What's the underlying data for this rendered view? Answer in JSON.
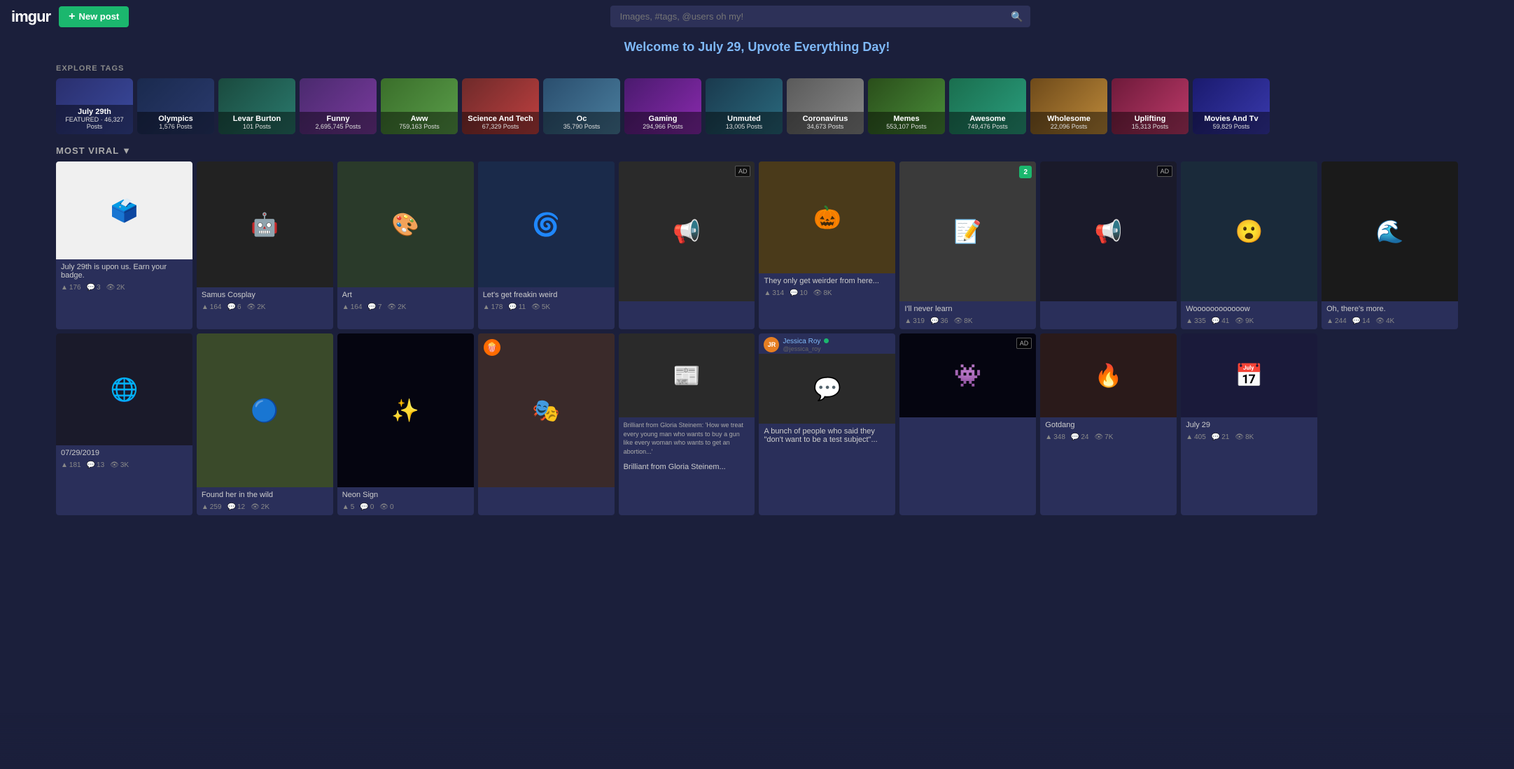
{
  "header": {
    "logo": "imgur",
    "new_post_label": "New post",
    "search_placeholder": "Images, #tags, @users oh my!"
  },
  "welcome": {
    "text": "Welcome to July 29, Upvote Everything Day!"
  },
  "explore": {
    "label": "EXPLORE TAGS",
    "tags": [
      {
        "id": "july29",
        "name": "July 29th",
        "sub": "FEATURED · 46,327 Posts",
        "cls": "tag-featured"
      },
      {
        "id": "olympics",
        "name": "Olympics",
        "sub": "1,576 Posts",
        "cls": "tag-olympics"
      },
      {
        "id": "levar",
        "name": "Levar Burton",
        "sub": "101 Posts",
        "cls": "tag-levar"
      },
      {
        "id": "funny",
        "name": "Funny",
        "sub": "2,695,745 Posts",
        "cls": "tag-funny"
      },
      {
        "id": "aww",
        "name": "Aww",
        "sub": "759,163 Posts",
        "cls": "tag-aww"
      },
      {
        "id": "scitech",
        "name": "Science And Tech",
        "sub": "67,329 Posts",
        "cls": "tag-scitech"
      },
      {
        "id": "oc",
        "name": "Oc",
        "sub": "35,790 Posts",
        "cls": "tag-oc"
      },
      {
        "id": "gaming",
        "name": "Gaming",
        "sub": "294,966 Posts",
        "cls": "tag-gaming"
      },
      {
        "id": "unmuted",
        "name": "Unmuted",
        "sub": "13,005 Posts",
        "cls": "tag-unmuted"
      },
      {
        "id": "coronavirus",
        "name": "Coronavirus",
        "sub": "34,673 Posts",
        "cls": "tag-coronavirus"
      },
      {
        "id": "memes",
        "name": "Memes",
        "sub": "553,107 Posts",
        "cls": "tag-memes"
      },
      {
        "id": "awesome",
        "name": "Awesome",
        "sub": "749,476 Posts",
        "cls": "tag-awesome"
      },
      {
        "id": "wholesome",
        "name": "Wholesome",
        "sub": "22,096 Posts",
        "cls": "tag-wholesome"
      },
      {
        "id": "uplifting",
        "name": "Uplifting",
        "sub": "15,313 Posts",
        "cls": "tag-uplifting"
      },
      {
        "id": "movies",
        "name": "Movies And Tv",
        "sub": "59,829 Posts",
        "cls": "tag-movies"
      }
    ]
  },
  "most_viral": {
    "label": "MOST VIRAL"
  },
  "posts": [
    {
      "id": "upvoted",
      "title": "July 29th is upon us. Earn your badge.",
      "thumb_color": "#f0f0f0",
      "thumb_text": "🗳️",
      "thumb_height": 140,
      "upvotes": "176",
      "comments": "3",
      "views": "2K",
      "has_ad": false,
      "span": 1
    },
    {
      "id": "samus",
      "title": "Samus Cosplay",
      "thumb_color": "#222",
      "thumb_text": "🤖",
      "thumb_height": 180,
      "upvotes": "164",
      "comments": "6",
      "views": "2K",
      "has_ad": false,
      "span": 1
    },
    {
      "id": "art",
      "title": "Art",
      "thumb_color": "#2a3a2a",
      "thumb_text": "🎨",
      "thumb_height": 180,
      "upvotes": "164",
      "comments": "7",
      "views": "2K",
      "has_ad": false,
      "span": 1
    },
    {
      "id": "weird",
      "title": "Let's get freakin weird",
      "thumb_color": "#1a2a4a",
      "thumb_text": "🌀",
      "thumb_height": 180,
      "upvotes": "178",
      "comments": "11",
      "views": "5K",
      "has_ad": false,
      "span": 1
    },
    {
      "id": "ad1",
      "title": "",
      "thumb_color": "#2a2a2a",
      "thumb_text": "📢",
      "thumb_height": 200,
      "upvotes": "",
      "comments": "",
      "views": "",
      "has_ad": true,
      "span": 1
    },
    {
      "id": "pumpkin",
      "title": "They only get weirder from here...",
      "thumb_color": "#4a3a1a",
      "thumb_text": "🎃",
      "thumb_height": 160,
      "upvotes": "314",
      "comments": "10",
      "views": "8K",
      "has_ad": false,
      "span": 1
    },
    {
      "id": "notice",
      "title": "I'll never learn",
      "thumb_color": "#3a3a3a",
      "thumb_text": "📝",
      "thumb_height": 200,
      "upvotes": "319",
      "comments": "36",
      "views": "8K",
      "has_ad": false,
      "num_badge": "2",
      "span": 1
    },
    {
      "id": "ad2",
      "title": "",
      "thumb_color": "#1a1a2a",
      "thumb_text": "📢",
      "thumb_height": 200,
      "upvotes": "",
      "comments": "",
      "views": "",
      "has_ad": true,
      "span": 1
    },
    {
      "id": "woooo",
      "title": "Woooooooooooow",
      "thumb_color": "#1a2a3a",
      "thumb_text": "😮",
      "thumb_height": 200,
      "upvotes": "335",
      "comments": "41",
      "views": "9K",
      "has_ad": false,
      "span": 1
    },
    {
      "id": "oc_more",
      "title": "Oh, there's more.",
      "thumb_color": "#1a1a1a",
      "thumb_text": "🌊",
      "thumb_height": 200,
      "upvotes": "244",
      "comments": "14",
      "views": "4K",
      "has_ad": false,
      "span": 1
    },
    {
      "id": "ie_meme",
      "title": "07/29/2019",
      "thumb_color": "#1a1a2a",
      "thumb_text": "🌐",
      "thumb_height": 160,
      "upvotes": "181",
      "comments": "13",
      "views": "3K",
      "has_ad": false,
      "span": 1
    },
    {
      "id": "wild",
      "title": "Found her in the wild",
      "thumb_color": "#3a4a2a",
      "thumb_text": "🔵",
      "thumb_height": 220,
      "upvotes": "259",
      "comments": "12",
      "views": "2K",
      "has_ad": false,
      "span": 1
    },
    {
      "id": "neon",
      "title": "Neon Sign",
      "thumb_color": "#050510",
      "thumb_text": "✨",
      "thumb_height": 220,
      "upvotes": "5",
      "comments": "0",
      "views": "0",
      "has_ad": false,
      "span": 1
    },
    {
      "id": "gotcha",
      "title": "",
      "thumb_color": "#3a2a2a",
      "thumb_text": "🎭",
      "thumb_height": 220,
      "upvotes": "",
      "comments": "",
      "views": "",
      "has_ad": false,
      "span": 1,
      "has_popcorn": true
    },
    {
      "id": "gloria",
      "title": "Brilliant from Gloria Steinem...",
      "thumb_color": "#2a2a2a",
      "thumb_text": "📰",
      "thumb_height": 120,
      "upvotes": "",
      "comments": "",
      "views": "",
      "has_ad": false,
      "span": 1,
      "body_text": "Brilliant from Gloria Steinem: 'How we treat every young man who wants to buy a gun like every woman who wants to get an abortion...'"
    },
    {
      "id": "jessica",
      "title": "A bunch of people who said they \"don't want to be a test subject\"...",
      "thumb_color": "#2a2a2a",
      "thumb_text": "💬",
      "thumb_height": 100,
      "upvotes": "",
      "comments": "",
      "views": "",
      "has_ad": false,
      "span": 1,
      "has_avatar": true,
      "avatar_name": "Jessica Roy",
      "avatar_handle": "@jessica_roy"
    },
    {
      "id": "alienware",
      "title": "",
      "thumb_color": "#050510",
      "thumb_text": "👾",
      "thumb_height": 120,
      "upvotes": "",
      "comments": "",
      "views": "",
      "has_ad": true,
      "span": 1
    },
    {
      "id": "gotdang",
      "title": "Gotdang",
      "thumb_color": "#2a1a1a",
      "thumb_text": "🔥",
      "thumb_height": 120,
      "upvotes": "348",
      "comments": "24",
      "views": "7K",
      "has_ad": false,
      "span": 1
    },
    {
      "id": "july29_2",
      "title": "July 29",
      "thumb_color": "#1a1a3a",
      "thumb_text": "📅",
      "thumb_height": 120,
      "upvotes": "405",
      "comments": "21",
      "views": "8K",
      "has_ad": false,
      "span": 1
    }
  ],
  "icons": {
    "upvote": "▲",
    "comment": "💬",
    "view": "👁",
    "search": "🔍",
    "chevron": "▼"
  }
}
